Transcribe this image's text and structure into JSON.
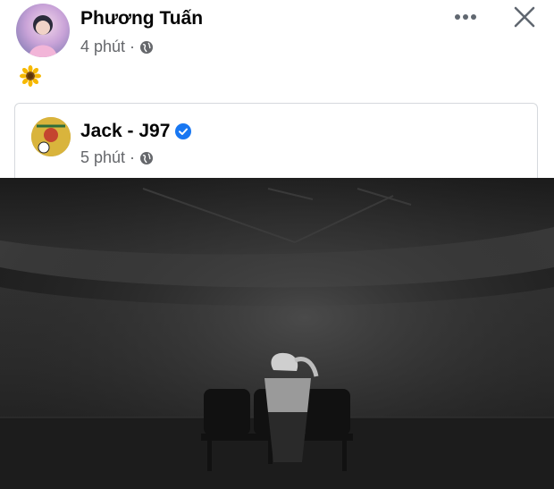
{
  "post": {
    "author": "Phương Tuấn",
    "time": "4 phút",
    "separator": "·",
    "content_emoji": "🌻"
  },
  "shared_post": {
    "author": "Jack - J97",
    "time": "5 phút",
    "separator": "·",
    "verified": true
  },
  "icons": {
    "more": "more-horizontal-icon",
    "close": "close-icon",
    "globe": "globe-icon",
    "verified": "verified-badge-icon"
  },
  "colors": {
    "text_primary": "#050505",
    "text_secondary": "#65676b",
    "verified_blue": "#1877f2"
  }
}
